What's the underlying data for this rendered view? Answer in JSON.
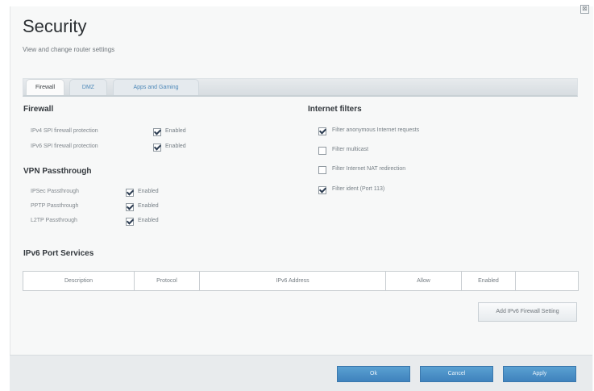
{
  "header": {
    "title": "Security",
    "subtitle": "View and change router settings",
    "close_label": "⊠"
  },
  "tabs": [
    {
      "label": "Firewall",
      "active": true
    },
    {
      "label": "DMZ",
      "active": false
    },
    {
      "label": "Apps and Gaming",
      "active": false
    }
  ],
  "firewall": {
    "title": "Firewall",
    "rows": [
      {
        "label": "IPv4 SPI firewall protection",
        "checkbox": "Enabled",
        "checked": true
      },
      {
        "label": "IPv6 SPI firewall protection",
        "checkbox": "Enabled",
        "checked": true
      }
    ]
  },
  "vpn": {
    "title": "VPN Passthrough",
    "rows": [
      {
        "label": "IPSec Passthrough",
        "checkbox": "Enabled",
        "checked": true
      },
      {
        "label": "PPTP Passthrough",
        "checkbox": "Enabled",
        "checked": true
      },
      {
        "label": "L2TP Passthrough",
        "checkbox": "Enabled",
        "checked": true
      }
    ]
  },
  "internet_filters": {
    "title": "Internet filters",
    "items": [
      {
        "label": "Filter anonymous Internet requests",
        "checked": true
      },
      {
        "label": "Filter multicast",
        "checked": false
      },
      {
        "label": "Filter Internet NAT redirection",
        "checked": false
      },
      {
        "label": "Filter ident (Port 113)",
        "checked": true
      }
    ]
  },
  "ipv6": {
    "title": "IPv6 Port Services",
    "columns": [
      "Description",
      "Protocol",
      "IPv6 Address",
      "Allow",
      "Enabled",
      ""
    ],
    "add_button": "Add IPv6 Firewall Setting"
  },
  "footer": {
    "ok": "Ok",
    "cancel": "Cancel",
    "apply": "Apply"
  }
}
